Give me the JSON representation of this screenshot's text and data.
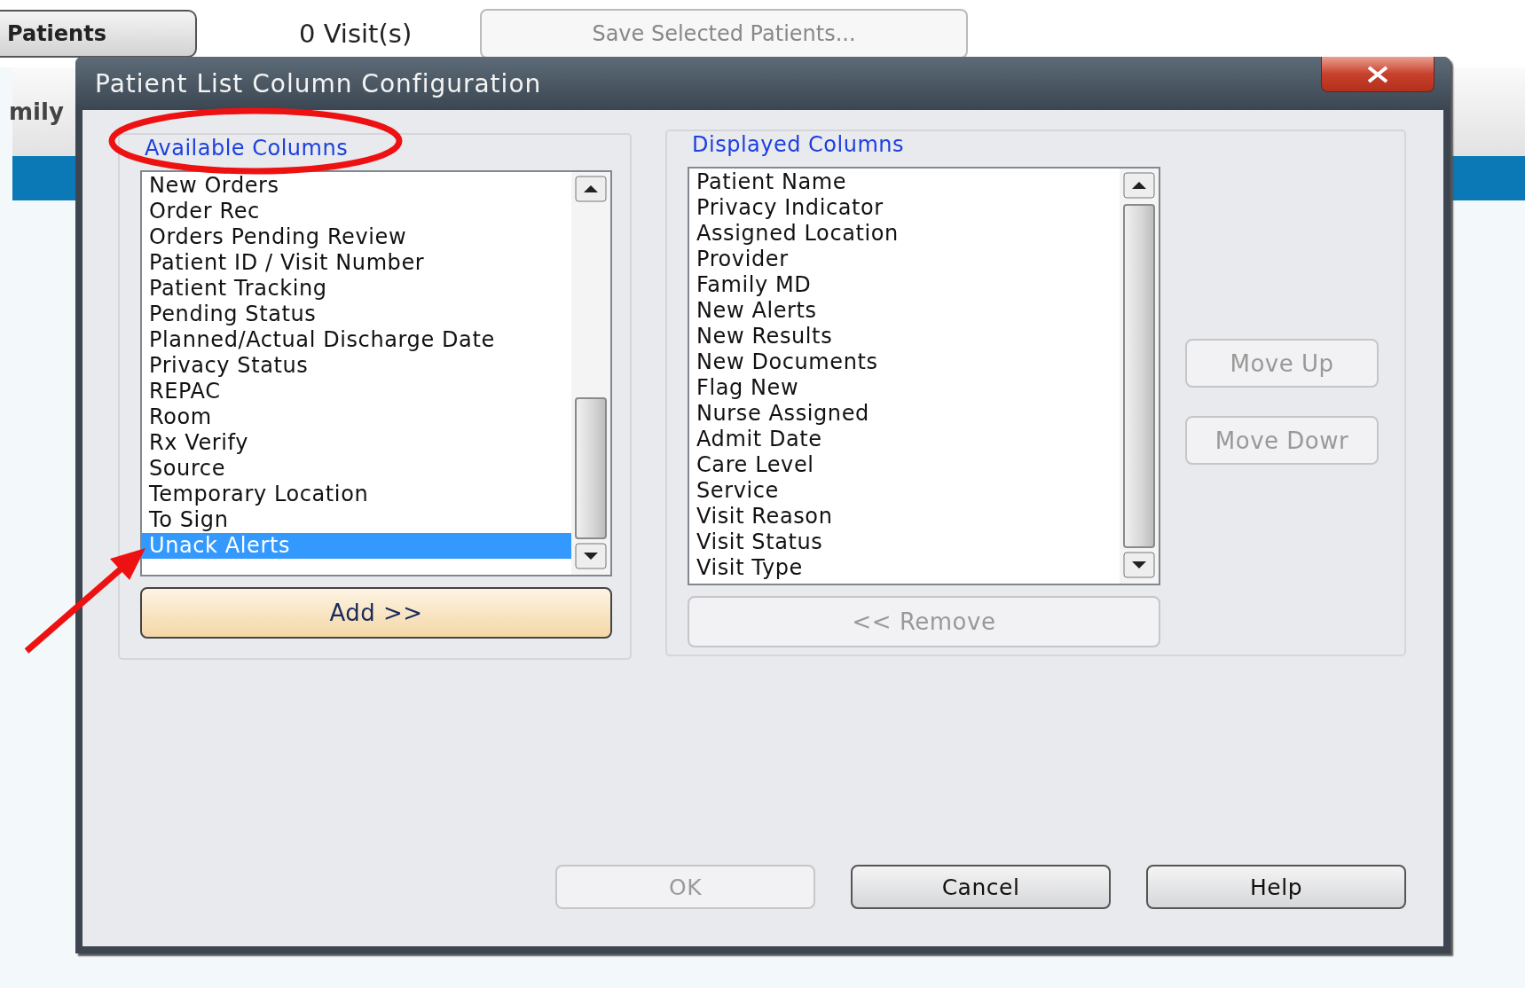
{
  "app": {
    "patients_button": "Patients",
    "visit_count": "0 Visit(s)",
    "save_button": {
      "label": "Save Selected Patients...",
      "disabled": true
    },
    "header_text": "mily"
  },
  "dialog": {
    "title": "Patient List Column Configuration",
    "available": {
      "label": "Available Columns",
      "items": [
        {
          "text": "New Orders",
          "selected": false
        },
        {
          "text": "Order Rec",
          "selected": false
        },
        {
          "text": "Orders Pending Review",
          "selected": false
        },
        {
          "text": "Patient ID / Visit Number",
          "selected": false
        },
        {
          "text": "Patient Tracking",
          "selected": false
        },
        {
          "text": "Pending Status",
          "selected": false
        },
        {
          "text": "Planned/Actual Discharge Date",
          "selected": false
        },
        {
          "text": "Privacy Status",
          "selected": false
        },
        {
          "text": "REPAC",
          "selected": false
        },
        {
          "text": "Room",
          "selected": false
        },
        {
          "text": "Rx Verify",
          "selected": false
        },
        {
          "text": "Source",
          "selected": false
        },
        {
          "text": "Temporary Location",
          "selected": false
        },
        {
          "text": "To Sign",
          "selected": false
        },
        {
          "text": "Unack Alerts",
          "selected": true
        }
      ],
      "add_button": {
        "label": "Add >>",
        "disabled": false,
        "highlighted": true
      }
    },
    "displayed": {
      "label": "Displayed Columns",
      "items": [
        {
          "text": "Patient Name",
          "selected": false
        },
        {
          "text": "Privacy Indicator",
          "selected": false
        },
        {
          "text": "Assigned Location",
          "selected": false
        },
        {
          "text": "Provider",
          "selected": false
        },
        {
          "text": "Family MD",
          "selected": false
        },
        {
          "text": "New Alerts",
          "selected": false
        },
        {
          "text": "New Results",
          "selected": false
        },
        {
          "text": "New Documents",
          "selected": false
        },
        {
          "text": "Flag New",
          "selected": false
        },
        {
          "text": "Nurse Assigned",
          "selected": false
        },
        {
          "text": "Admit Date",
          "selected": false
        },
        {
          "text": "Care Level",
          "selected": false
        },
        {
          "text": "Service",
          "selected": false
        },
        {
          "text": "Visit Reason",
          "selected": false
        },
        {
          "text": "Visit Status",
          "selected": false
        },
        {
          "text": "Visit Type",
          "selected": false
        }
      ],
      "remove_button": {
        "label": "<< Remove",
        "disabled": true,
        "highlighted": false
      },
      "move_buttons": [
        {
          "label": "Move Up",
          "disabled": true
        },
        {
          "label": "Move Dowr",
          "disabled": true
        }
      ]
    },
    "buttons": [
      {
        "label": "OK",
        "disabled": true
      },
      {
        "label": "Cancel",
        "disabled": false
      },
      {
        "label": "Help",
        "disabled": false
      }
    ]
  }
}
